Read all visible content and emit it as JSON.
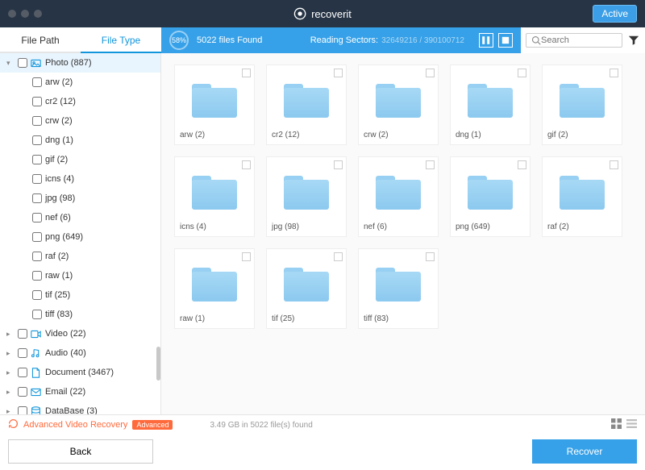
{
  "header": {
    "brand": "recoverit",
    "active_badge": "Active"
  },
  "tabs": {
    "file_path": "File Path",
    "file_type": "File Type"
  },
  "scan": {
    "percent": "58%",
    "files_found": "5022 files Found",
    "reading_label": "Reading Sectors:",
    "sectors": "32649216 / 390100712"
  },
  "search": {
    "placeholder": "Search"
  },
  "sidebar": {
    "categories": [
      {
        "label": "Photo (887)",
        "expanded": true,
        "selected": true,
        "icon": "photo"
      },
      {
        "label": "Video (22)",
        "icon": "video"
      },
      {
        "label": "Audio (40)",
        "icon": "audio"
      },
      {
        "label": "Document (3467)",
        "icon": "document"
      },
      {
        "label": "Email (22)",
        "icon": "email"
      },
      {
        "label": "DataBase (3)",
        "icon": "database"
      }
    ],
    "photo_children": [
      "arw (2)",
      "cr2 (12)",
      "crw (2)",
      "dng (1)",
      "gif (2)",
      "icns (4)",
      "jpg (98)",
      "nef (6)",
      "png (649)",
      "raf (2)",
      "raw (1)",
      "tif (25)",
      "tiff (83)"
    ]
  },
  "folders": [
    "arw (2)",
    "cr2 (12)",
    "crw (2)",
    "dng (1)",
    "gif (2)",
    "icns (4)",
    "jpg (98)",
    "nef (6)",
    "png (649)",
    "raf (2)",
    "raw (1)",
    "tif (25)",
    "tiff (83)"
  ],
  "footer": {
    "adv_text": "Advanced Video Recovery",
    "adv_badge": "Advanced",
    "summary": "3.49 GB in 5022 file(s) found",
    "back": "Back",
    "recover": "Recover"
  }
}
